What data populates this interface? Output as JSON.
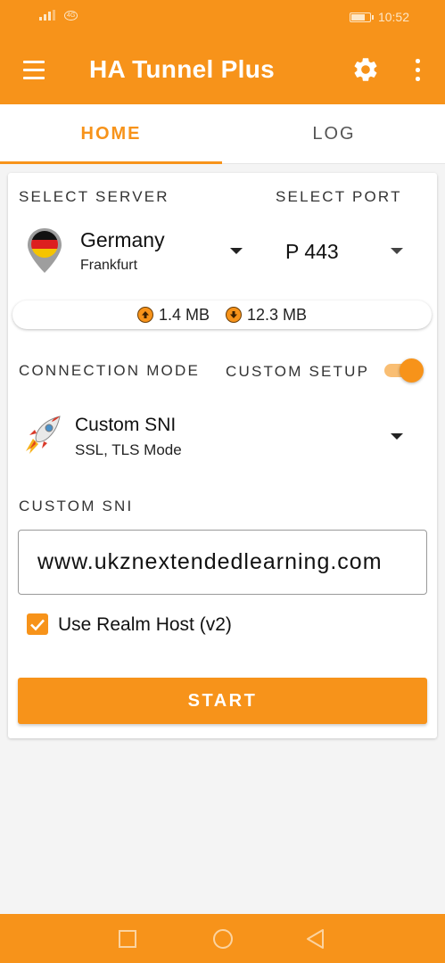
{
  "status_bar": {
    "time": "10:52",
    "left_indicator": "4G"
  },
  "app_bar": {
    "title": "HA Tunnel Plus"
  },
  "tabs": [
    {
      "label": "HOME",
      "active": true
    },
    {
      "label": "LOG",
      "active": false
    }
  ],
  "server": {
    "section_label": "SELECT SERVER",
    "country": "Germany",
    "city": "Frankfurt",
    "flag_icon": "germany-flag-pin"
  },
  "port": {
    "section_label": "SELECT PORT",
    "value": "P 443"
  },
  "traffic": {
    "upload": "1.4 MB",
    "download": "12.3 MB"
  },
  "connection": {
    "section_label": "CONNECTION MODE",
    "custom_setup_label": "CUSTOM SETUP",
    "custom_setup_enabled": true,
    "mode_name": "Custom SNI",
    "mode_sub": "SSL, TLS Mode",
    "mode_icon": "rocket-icon"
  },
  "custom_sni": {
    "section_label": "CUSTOM SNI",
    "value": "www.ukznextendedlearning.com"
  },
  "realm_host": {
    "label": "Use Realm Host (v2)",
    "checked": true
  },
  "start_button": {
    "label": "START"
  },
  "colors": {
    "accent": "#f7931a",
    "toggle_track": "#f9be73",
    "background": "#f4f4f4"
  }
}
